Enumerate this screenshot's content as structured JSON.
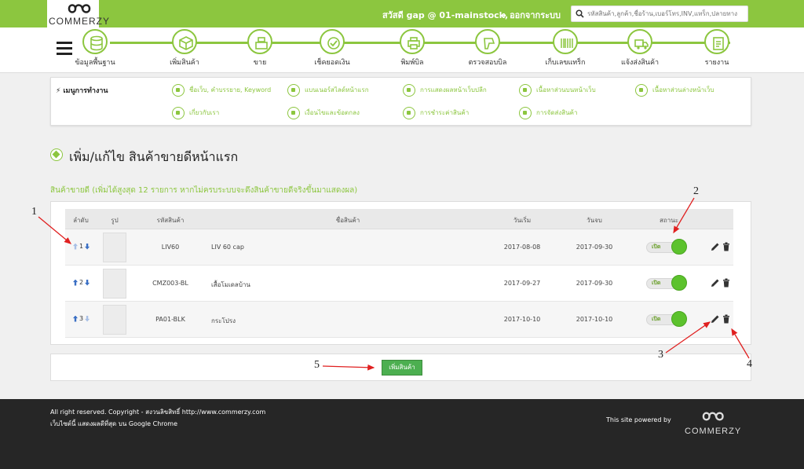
{
  "brand": {
    "logo_text": "COMMERZY"
  },
  "header": {
    "greeting": "สวัสดี gap @ 01-mainstock,",
    "logout_label": "ออกจากระบบ",
    "search_placeholder": "รหัสสินค้า,ลูกค้า,ชื่อร้าน,เบอร์โทร,INV,แทร็ก,ปลายทาง"
  },
  "steps": [
    {
      "label": "ข้อมูลพื้นฐาน",
      "icon": "database-icon"
    },
    {
      "label": "เพิ่มสินค้า",
      "icon": "box-icon"
    },
    {
      "label": "ขาย",
      "icon": "cash-register-icon"
    },
    {
      "label": "เช็คยอดเงิน",
      "icon": "check-money-icon"
    },
    {
      "label": "พิมพ์บิล",
      "icon": "printer-icon"
    },
    {
      "label": "ตรวจสอบบิล",
      "icon": "scanner-icon"
    },
    {
      "label": "เก็บเลขแทร็ก",
      "icon": "barcode-icon"
    },
    {
      "label": "แจ้งส่งสินค้า",
      "icon": "truck-icon"
    },
    {
      "label": "รายงาน",
      "icon": "report-icon"
    }
  ],
  "work_menu": {
    "title": "เมนูการทำงาน",
    "items": [
      "ชื่อเว็บ, คำบรรยาย, Keyword",
      "แบนเนอร์สไลด์หน้าแรก",
      "การแสดงผลหน้าเว็บปลีก",
      "เนื้อหาส่วนบนหน้าเว็บ",
      "เนื้อหาส่วนล่างหน้าเว็บ",
      "เกี่ยวกับเรา",
      "เงื่อนไขและข้อตกลง",
      "การชำระค่าสินค้า",
      "การจัดส่งสินค้า"
    ]
  },
  "page": {
    "title": "เพิ่ม/แก้ไข สินค้าขายดีหน้าแรก",
    "subtitle": "สินค้าขายดี (เพิ่มได้สูงสุด 12 รายการ หากไม่ครบระบบจะดึงสินค้าขายดีจริงขึ้นมาแสดงผล)"
  },
  "table": {
    "headers": [
      "ลำดับ",
      "รูป",
      "รหัสสินค้า",
      "ชื่อสินค้า",
      "วันเริ่ม",
      "วันจบ",
      "สถานะ"
    ],
    "rows": [
      {
        "order": "1",
        "code": "LIV60",
        "name": "LIV 60 cap",
        "start": "2017-08-08",
        "end": "2017-09-30",
        "status": "เปิด"
      },
      {
        "order": "2",
        "code": "CMZ003-BL",
        "name": "เสื้อโมเดลบ้าน",
        "start": "2017-09-27",
        "end": "2017-09-30",
        "status": "เปิด"
      },
      {
        "order": "3",
        "code": "PA01-BLK",
        "name": "กระโปรง",
        "start": "2017-10-10",
        "end": "2017-10-10",
        "status": "เปิด"
      }
    ]
  },
  "add_button_label": "เพิ่มสินค้า",
  "callouts": [
    "1",
    "2",
    "3",
    "4",
    "5"
  ],
  "footer": {
    "line1": "All right reserved. Copyright - สงวนลิขสิทธิ์ http://www.commerzy.com",
    "line2": "เว็บไซต์นี้ แสดงผลดีที่สุด บน Google Chrome",
    "powered": "This site powered by",
    "logo_text": "COMMERZY"
  },
  "colors": {
    "accent": "#8cc63f",
    "footer_bg": "#262626",
    "toggle_on": "#5cc22d",
    "add_button": "#4caf50"
  }
}
